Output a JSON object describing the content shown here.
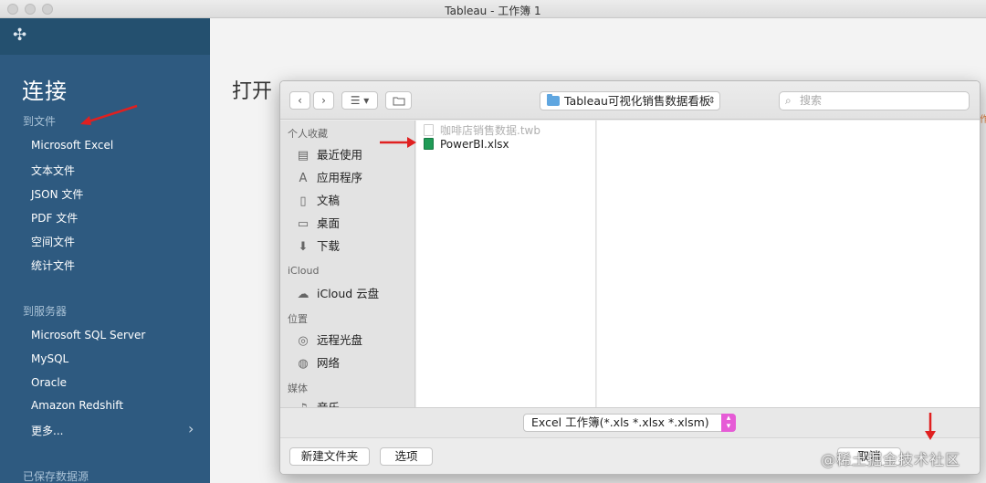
{
  "window": {
    "title": "Tableau - 工作簿 1"
  },
  "sidebar": {
    "logo_icon": "tableau-logo-icon",
    "connect_title": "连接",
    "to_file": {
      "heading": "到文件",
      "items": [
        "Microsoft Excel",
        "文本文件",
        "JSON 文件",
        "PDF 文件",
        "空间文件",
        "统计文件"
      ]
    },
    "to_server": {
      "heading": "到服务器",
      "items": [
        "Microsoft SQL Server",
        "MySQL",
        "Oracle",
        "Amazon Redshift",
        "更多..."
      ]
    },
    "saved_sources": {
      "heading": "已保存数据源"
    }
  },
  "main": {
    "open_title": "打开"
  },
  "dialog": {
    "toolbar": {
      "back": "‹",
      "forward": "›",
      "view_mode": "☰ ▾",
      "new_folder_icon": "folder-icon",
      "path": "Tableau可视化销售数据看板",
      "search_placeholder": "搜索"
    },
    "side": {
      "favorites_heading": "个人收藏",
      "favorites": [
        {
          "label": "最近使用",
          "icon": "recent-icon",
          "glyph": "▤"
        },
        {
          "label": "应用程序",
          "icon": "applications-icon",
          "glyph": "A"
        },
        {
          "label": "文稿",
          "icon": "documents-icon",
          "glyph": "▯"
        },
        {
          "label": "桌面",
          "icon": "desktop-icon",
          "glyph": "▭"
        },
        {
          "label": "下载",
          "icon": "download-icon",
          "glyph": "⬇"
        }
      ],
      "icloud_heading": "iCloud",
      "icloud": [
        {
          "label": "iCloud 云盘",
          "icon": "cloud-icon",
          "glyph": "☁"
        }
      ],
      "locations_heading": "位置",
      "locations": [
        {
          "label": "远程光盘",
          "icon": "disc-icon",
          "glyph": "◎"
        },
        {
          "label": "网络",
          "icon": "network-icon",
          "glyph": "◍"
        }
      ],
      "media_heading": "媒体",
      "media": [
        {
          "label": "音乐",
          "icon": "music-icon",
          "glyph": "♫"
        }
      ]
    },
    "files": [
      {
        "name": "咖啡店销售数据.twb",
        "enabled": false
      },
      {
        "name": "PowerBI.xlsx",
        "enabled": true
      }
    ],
    "filter": {
      "value": "Excel 工作簿(*.xls *.xlsx *.xlsm)"
    },
    "buttons": {
      "new_folder": "新建文件夹",
      "options": "选项",
      "cancel": "取消"
    }
  },
  "annotations": {
    "arrow_color": "#e02020"
  },
  "watermark": "@稀土掘金技术社区",
  "edge_text": "作"
}
